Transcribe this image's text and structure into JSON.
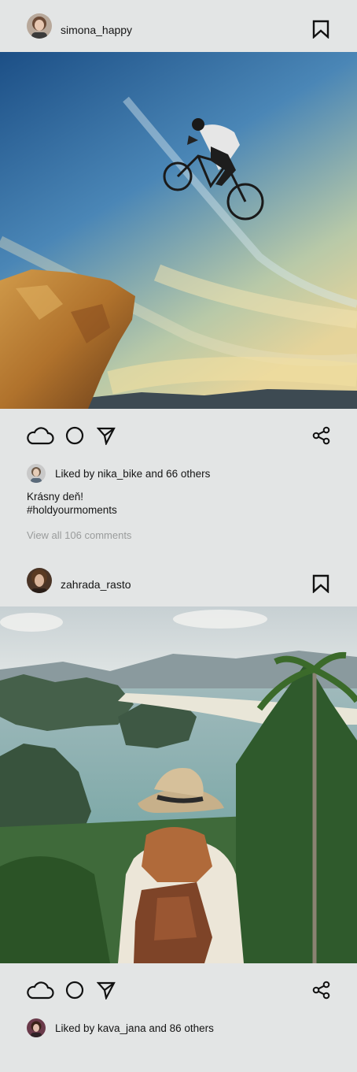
{
  "posts": [
    {
      "username": "simona_happy",
      "likes_text": "Liked by nika_bike and 66 others",
      "caption_line1": "Krásny deň!",
      "caption_line2": "#holdyourmoments",
      "view_comments": "View all 106 comments"
    },
    {
      "username": "zahrada_rasto",
      "likes_text": "Liked by kava_jana and 86 others"
    }
  ],
  "icons": {
    "bookmark": "bookmark-icon",
    "like": "cloud-icon",
    "comment": "circle-icon",
    "send": "send-icon",
    "share": "share-icon"
  },
  "colors": {
    "background": "#e3e5e5",
    "text": "#151515",
    "muted": "#9a9c9c"
  }
}
